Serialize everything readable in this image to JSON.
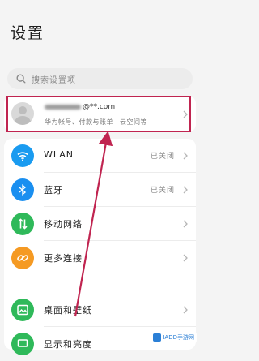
{
  "page_title": "设置",
  "search": {
    "placeholder": "搜索设置项"
  },
  "account": {
    "email_suffix": "@**.com",
    "desc_parts": [
      "华为帐号",
      "付款与账单",
      "云空间等"
    ]
  },
  "settings": [
    {
      "label": "WLAN",
      "status": "已关闭",
      "color": "#1a9bf0",
      "icon": "wifi-icon"
    },
    {
      "label": "蓝牙",
      "status": "已关闭",
      "color": "#1a8ff0",
      "icon": "bluetooth-icon"
    },
    {
      "label": "移动网络",
      "status": "",
      "color": "#2fb95a",
      "icon": "mobile-data-icon"
    },
    {
      "label": "更多连接",
      "status": "",
      "color": "#f59a23",
      "icon": "link-icon"
    },
    {
      "label": "桌面和壁纸",
      "status": "",
      "color": "#2fb95a",
      "icon": "wallpaper-icon"
    },
    {
      "label": "显示和亮度",
      "status": "",
      "color": "#2fb95a",
      "icon": "display-icon"
    }
  ],
  "watermark": {
    "text": "IADD手游网"
  },
  "colors": {
    "highlight": "#c02450",
    "arrow": "#c02450"
  }
}
